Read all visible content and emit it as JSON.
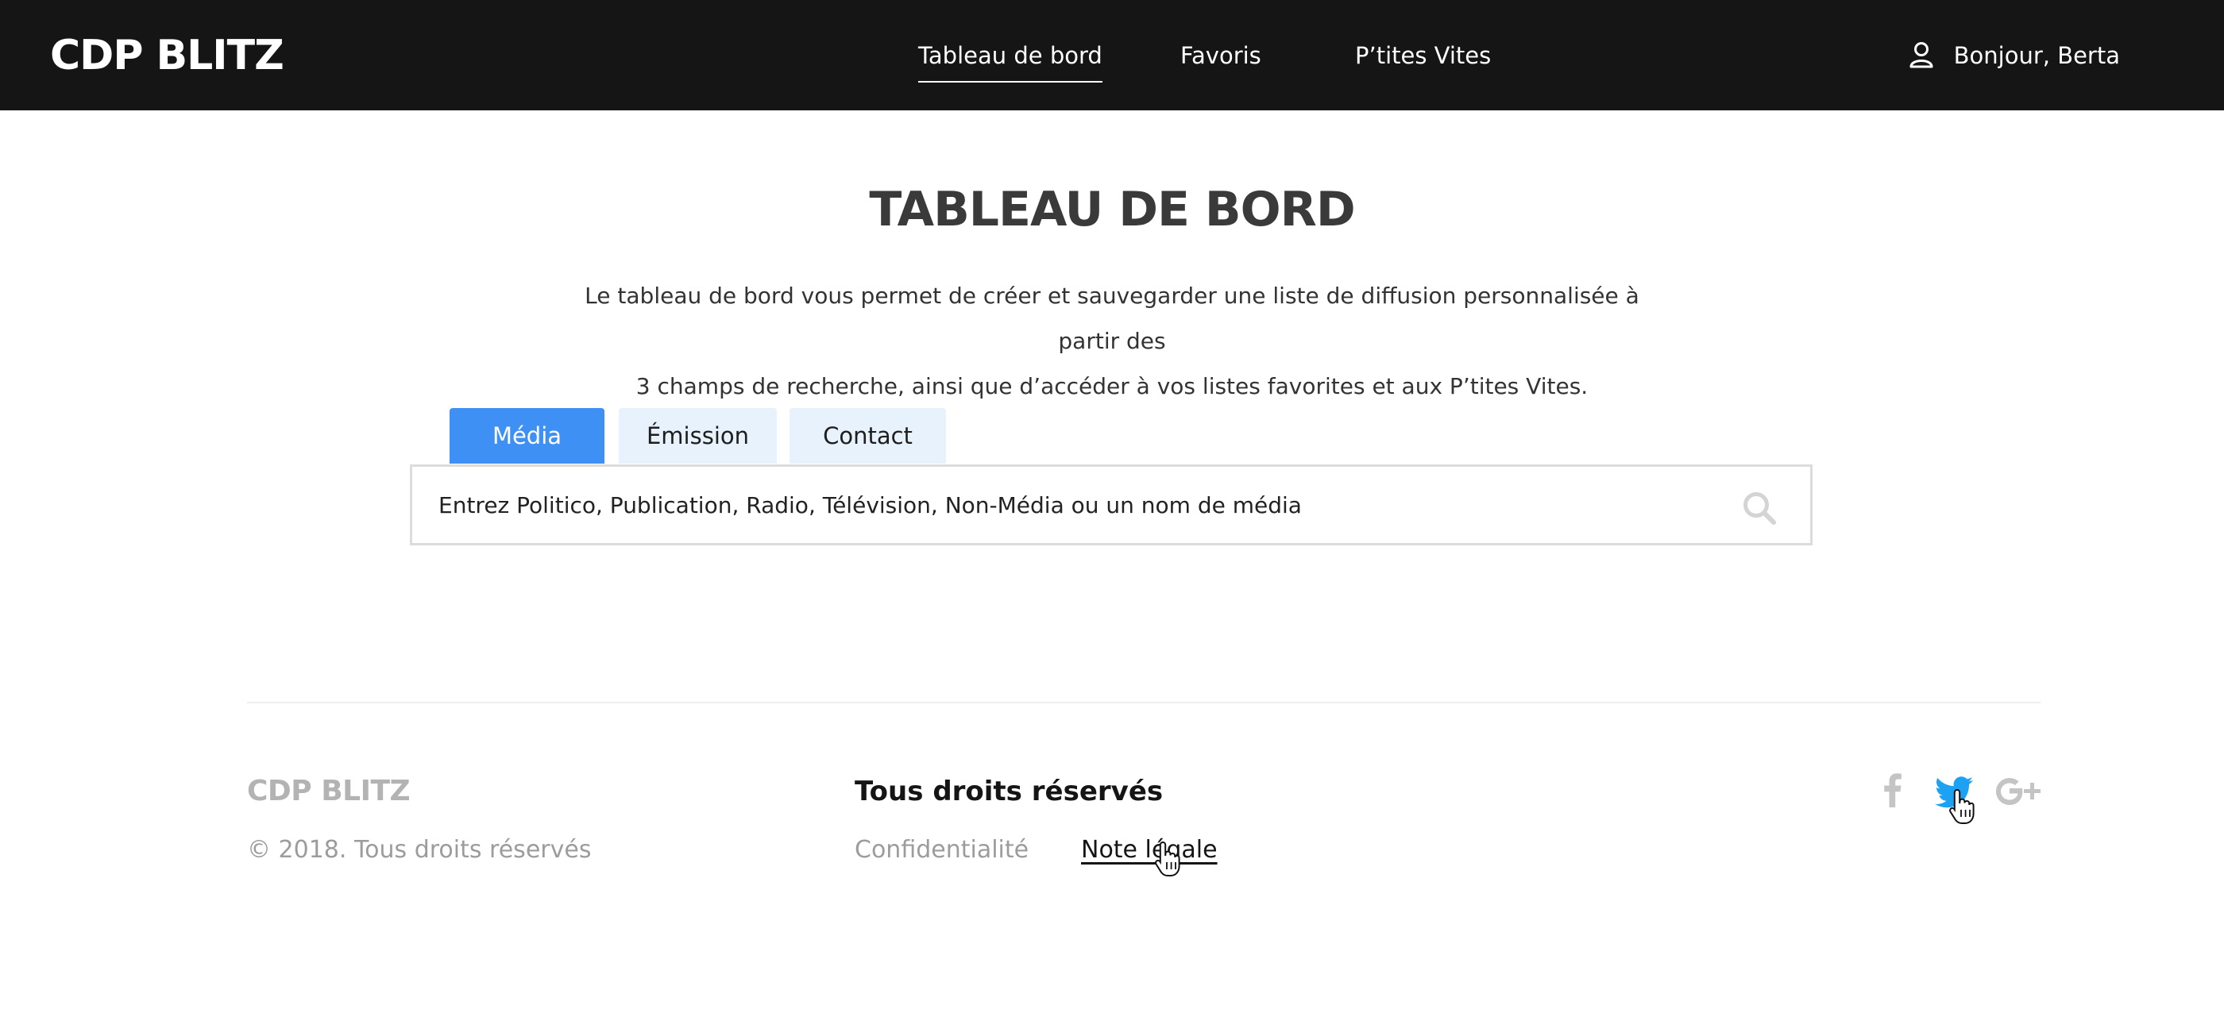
{
  "header": {
    "logo": "CDP BLITZ",
    "nav": [
      {
        "label": "Tableau de bord",
        "active": true
      },
      {
        "label": "Favoris",
        "active": false
      },
      {
        "label": "P’tites Vites",
        "active": false
      }
    ],
    "user_greeting": "Bonjour, Berta",
    "user_icon": "user-icon"
  },
  "main": {
    "title": "TABLEAU DE BORD",
    "intro_line1": "Le tableau de bord vous permet de créer et sauvegarder une liste de diffusion personnalisée à partir des",
    "intro_line2": "3 champs de recherche, ainsi que d’accéder à vos listes favorites et aux P’tites Vites.",
    "tabs": [
      {
        "label": "Média",
        "active": true
      },
      {
        "label": "Émission",
        "active": false
      },
      {
        "label": "Contact",
        "active": false
      }
    ],
    "search": {
      "value": "",
      "placeholder": "Entrez Politico, Publication, Radio, Télévision, Non-Média ou un nom de média",
      "icon": "search-icon"
    }
  },
  "footer": {
    "logo": "CDP BLITZ",
    "copyright": "© 2018. Tous droits réservés",
    "rights_title": "Tous droits réservés",
    "links": [
      {
        "label": "Confidentialité"
      },
      {
        "label": "Note légale"
      }
    ],
    "social": [
      "facebook-icon",
      "twitter-icon",
      "google-plus-icon"
    ]
  },
  "colors": {
    "topbar": "#151515",
    "accent": "#3f90f5",
    "tab_inactive": "#e7f2fc",
    "twitter": "#1da1f2",
    "muted": "#9c9c9c"
  }
}
